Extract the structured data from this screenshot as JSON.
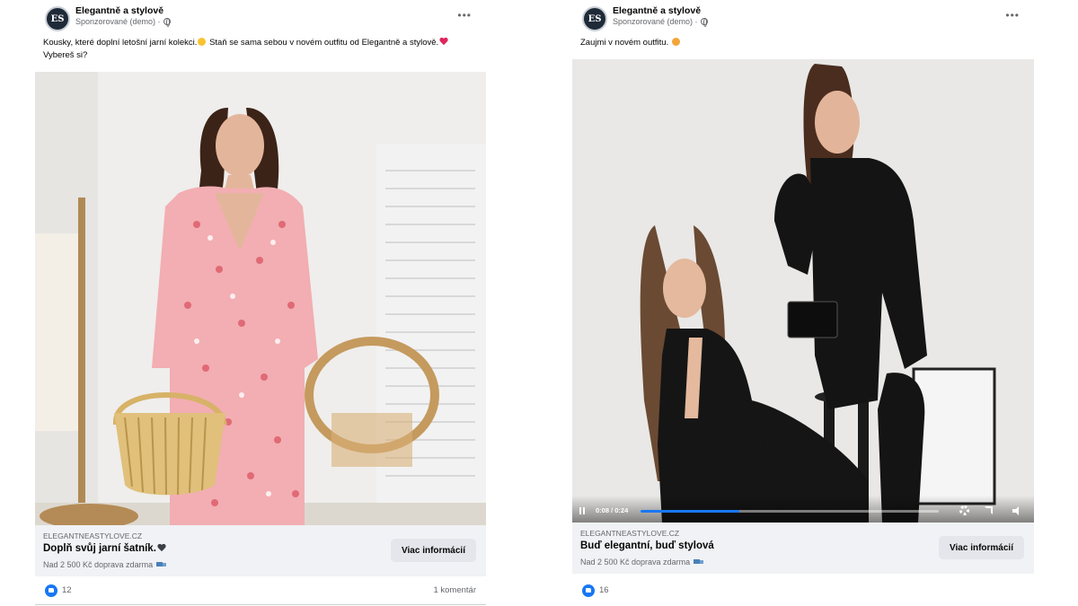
{
  "posts": [
    {
      "page_name": "Elegantně a stylově",
      "sponsored_label": "Sponzorované (demo) ·",
      "avatar_initials": "ES",
      "caption_part1": "Kousky, které doplní letošní jarní kolekci.",
      "caption_part2": " Staň se sama sebou v novém outfitu od Elegantně a stylově.",
      "caption_part3": " Vybereš si?",
      "media_type": "image",
      "domain": "ELEGANTNEASTYLOVE.CZ",
      "headline": "Doplň svůj jarní šatník.",
      "subline": "Nad 2 500 Kč doprava zdarma",
      "cta_label": "Viac informácií",
      "like_count": "12",
      "comments_label": "1 komentár"
    },
    {
      "page_name": "Elegantně a stylově",
      "sponsored_label": "Sponzorované (demo) ·",
      "avatar_initials": "ES",
      "caption": "Zaujmi v novém outfitu.",
      "media_type": "video",
      "video_time": "0:08 / 0:24",
      "video_progress": 0.33,
      "domain": "ELEGANTNEASTYLOVE.CZ",
      "headline": "Buď elegantní, buď stylová",
      "subline": "Nad 2 500 Kč doprava zdarma",
      "cta_label": "Viac informácií",
      "like_count": "16"
    }
  ],
  "colors": {
    "like_blue": "#1877f2",
    "footer_bg": "#f0f2f5",
    "button_bg": "#e4e6eb",
    "secondary_text": "#65676b"
  },
  "icons": [
    "more-icon",
    "globe-icon",
    "like-icon",
    "truck-icon",
    "pause-icon",
    "gear-icon",
    "fullscreen-icon",
    "volume-icon"
  ]
}
